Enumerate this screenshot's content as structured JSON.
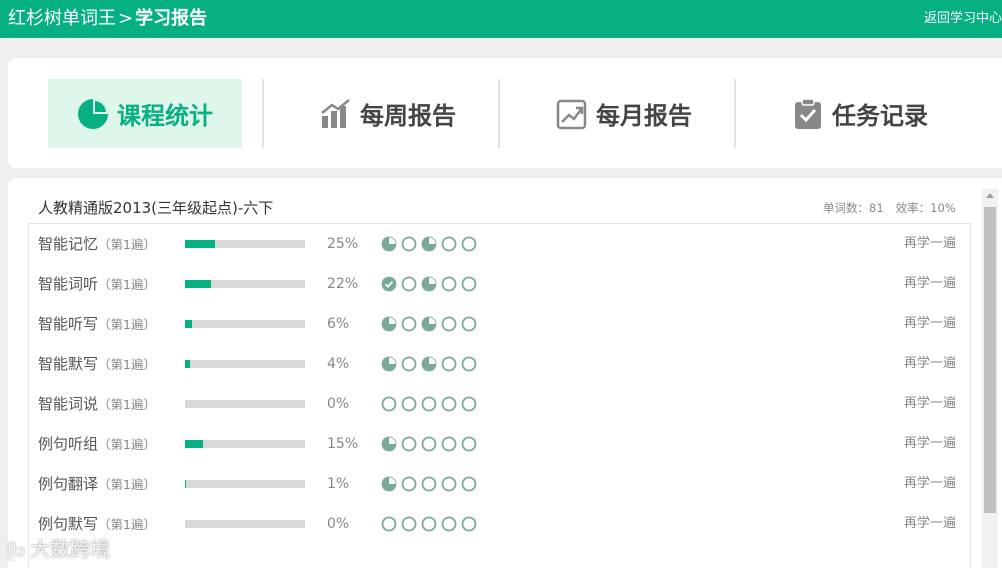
{
  "header": {
    "crumb_app": "红杉树单词王",
    "crumb_sep": ">",
    "crumb_current": "学习报告",
    "back_label": "返回学习中心"
  },
  "tabs": [
    {
      "label": "课程统计",
      "icon": "pie-chart-icon",
      "active": true
    },
    {
      "label": "每周报告",
      "icon": "bar-chart-icon",
      "active": false
    },
    {
      "label": "每月报告",
      "icon": "line-chart-icon",
      "active": false
    },
    {
      "label": "任务记录",
      "icon": "clipboard-check-icon",
      "active": false
    }
  ],
  "book": {
    "title": "人教精通版2013(三年级起点)-六下",
    "word_count": "单词数：81",
    "efficiency": "效率：10%"
  },
  "rows": [
    {
      "name": "智能记忆",
      "pass": "（第1遍）",
      "progress": 0.25,
      "percent": "25%",
      "circles": [
        "quarter",
        "empty",
        "quarter",
        "empty",
        "empty"
      ],
      "action": "再学一遍"
    },
    {
      "name": "智能词听",
      "pass": "（第1遍）",
      "progress": 0.22,
      "percent": "22%",
      "circles": [
        "check",
        "empty",
        "quarter",
        "empty",
        "empty"
      ],
      "action": "再学一遍"
    },
    {
      "name": "智能听写",
      "pass": "（第1遍）",
      "progress": 0.06,
      "percent": "6%",
      "circles": [
        "quarter",
        "empty",
        "quarter",
        "empty",
        "empty"
      ],
      "action": "再学一遍"
    },
    {
      "name": "智能默写",
      "pass": "（第1遍）",
      "progress": 0.04,
      "percent": "4%",
      "circles": [
        "quarter",
        "empty",
        "quarter",
        "empty",
        "empty"
      ],
      "action": "再学一遍"
    },
    {
      "name": "智能词说",
      "pass": "（第1遍）",
      "progress": 0.0,
      "percent": "0%",
      "circles": [
        "empty",
        "empty",
        "empty",
        "empty",
        "empty"
      ],
      "action": "再学一遍"
    },
    {
      "name": "例句听组",
      "pass": "（第1遍）",
      "progress": 0.15,
      "percent": "15%",
      "circles": [
        "quarter",
        "empty",
        "empty",
        "empty",
        "empty"
      ],
      "action": "再学一遍"
    },
    {
      "name": "例句翻译",
      "pass": "（第1遍）",
      "progress": 0.01,
      "percent": "1%",
      "circles": [
        "quarter",
        "empty",
        "empty",
        "empty",
        "empty"
      ],
      "action": "再学一遍"
    },
    {
      "name": "例句默写",
      "pass": "（第1遍）",
      "progress": 0.0,
      "percent": "0%",
      "circles": [
        "empty",
        "empty",
        "empty",
        "empty",
        "empty"
      ],
      "action": "再学一遍"
    }
  ],
  "watermark": "大数跨境",
  "colors": {
    "accent": "#07b083",
    "circle": "#7aa99a",
    "tab_active_bg": "#dff6ea"
  }
}
